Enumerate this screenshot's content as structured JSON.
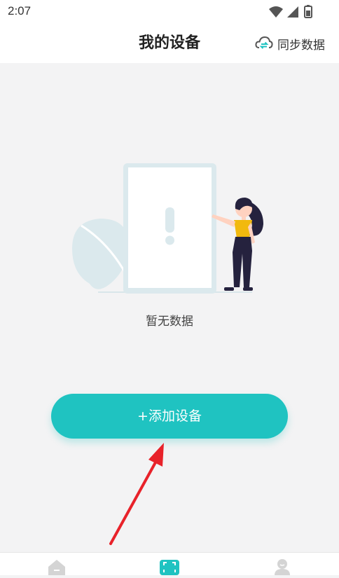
{
  "status_bar": {
    "time": "2:07",
    "icons": [
      "wifi-icon",
      "cellular-signal-icon",
      "battery-icon"
    ]
  },
  "header": {
    "title": "我的设备",
    "sync_label": "同步数据",
    "sync_icon": "cloud-sync-icon"
  },
  "empty_state": {
    "illustration": "empty-state-illustration",
    "text": "暂无数据"
  },
  "add_device": {
    "label": "+添加设备",
    "color": "#1fc3c1"
  },
  "annotation": {
    "arrow_color": "#e8222a"
  },
  "bottom_nav": {
    "items": [
      {
        "icon": "home-icon",
        "active": false
      },
      {
        "icon": "scan-device-icon",
        "active": true
      },
      {
        "icon": "profile-icon",
        "active": false
      }
    ]
  }
}
